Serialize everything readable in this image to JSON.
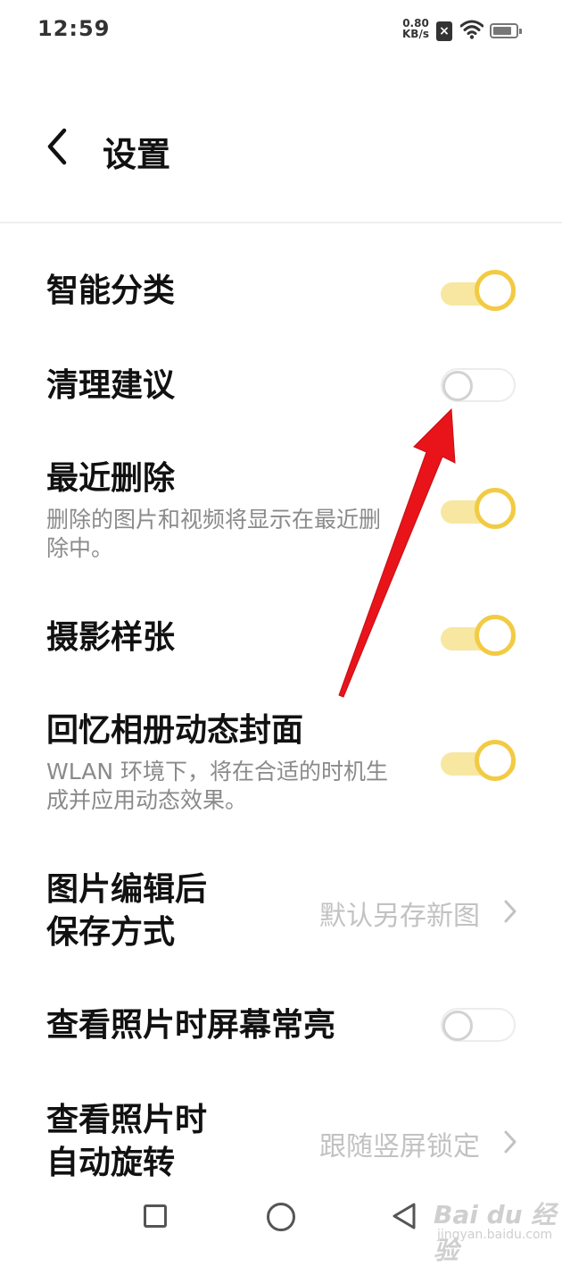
{
  "status_bar": {
    "time": "12:59",
    "speed_value": "0.80",
    "speed_unit": "KB/s",
    "notification_icon": "x-badge-icon",
    "wifi_icon": "wifi-icon",
    "battery_icon": "battery-icon"
  },
  "header": {
    "back_icon": "chevron-left-icon",
    "title": "设置"
  },
  "settings": [
    {
      "label": "智能分类",
      "type": "toggle",
      "on": true
    },
    {
      "label": "清理建议",
      "type": "toggle",
      "on": false
    },
    {
      "label": "最近删除",
      "sub": "删除的图片和视频将显示在最近删除中。",
      "type": "toggle",
      "on": true
    },
    {
      "label": "摄影样张",
      "type": "toggle",
      "on": true
    },
    {
      "label": "回忆相册动态封面",
      "sub": "WLAN 环境下，将在合适的时机生成并应用动态效果。",
      "type": "toggle",
      "on": true
    },
    {
      "label_line1": "图片编辑后",
      "label_line2": "保存方式",
      "type": "select",
      "value": "默认另存新图"
    },
    {
      "label": "查看照片时屏幕常亮",
      "type": "toggle",
      "on": false
    },
    {
      "label_line1": "查看照片时",
      "label_line2": "自动旋转",
      "type": "select",
      "value": "跟随竖屏锁定"
    }
  ],
  "annotation": {
    "icon": "red-arrow-icon",
    "color": "#e8141a"
  },
  "nav_bar": {
    "recents_icon": "square-icon",
    "home_icon": "circle-icon",
    "back_icon": "triangle-back-icon"
  },
  "watermark": {
    "logo": "Bai du 经验",
    "url": "jingyan.baidu.com"
  },
  "colors": {
    "toggle_on_knob": "#f2cb44",
    "toggle_on_track": "#f7e7a1",
    "toggle_off": "#d2d2d2",
    "secondary_text": "#8a8a8a",
    "value_text": "#c2c2c2"
  }
}
